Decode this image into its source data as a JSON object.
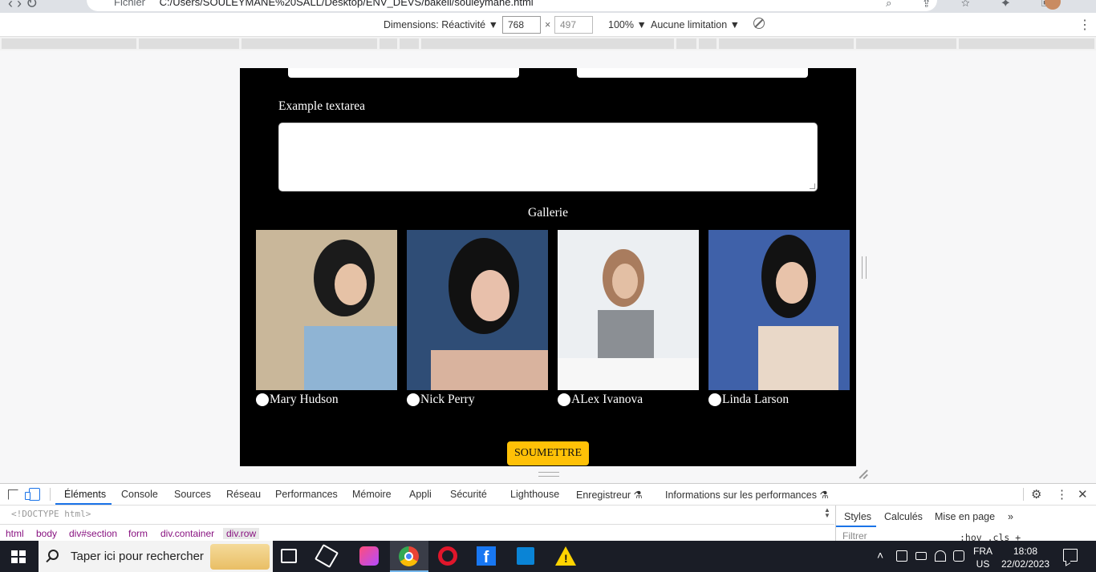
{
  "browser": {
    "url_scheme": "Fichier",
    "url_path": "C:/Users/SOULEYMANE%20SALL/Desktop/ENV_DEVS/bakeli/souleymane.html"
  },
  "device_toolbar": {
    "dimensions_label": "Dimensions: Réactivité ▼",
    "width_value": "768",
    "height_placeholder": "497",
    "zoom_label": "100% ▼",
    "throttle_label": "Aucune limitation ▼"
  },
  "page": {
    "textarea_label": "Example textarea",
    "gallery_title": "Gallerie",
    "gallery": [
      {
        "name": "Mary Hudson",
        "photo_colors": [
          "#c9b79a",
          "#1b1b1b",
          "#8fb4d4"
        ]
      },
      {
        "name": "Nick Perry",
        "photo_colors": [
          "#2f4d76",
          "#111111",
          "#e8c0ab"
        ]
      },
      {
        "name": "ALex Ivanova",
        "photo_colors": [
          "#eceff2",
          "#a97c5e",
          "#8b8f94"
        ]
      },
      {
        "name": "Linda Larson",
        "photo_colors": [
          "#3f61a9",
          "#121212",
          "#e9d8c8"
        ]
      }
    ],
    "submit_label": "SOUMETTRE",
    "submit_color": "#ffc107",
    "background_color": "#000000"
  },
  "devtools": {
    "tabs": [
      "Éléments",
      "Console",
      "Sources",
      "Réseau",
      "Performances",
      "Mémoire",
      "Appli",
      "Sécurité",
      "Lighthouse",
      "Enregistreur ⚗",
      "Informations sur les performances ⚗"
    ],
    "active_tab": "Éléments",
    "doctype": "<!DOCTYPE html>",
    "breadcrumbs": [
      "html",
      "body",
      "div#section",
      "form",
      "div.container",
      "div.row"
    ],
    "styles_tabs": [
      "Styles",
      "Calculés",
      "Mise en page",
      "»"
    ],
    "filter_placeholder": "Filtrer",
    "hov_cls": ":hov  .cls  +"
  },
  "taskbar": {
    "search_placeholder": "Taper ici pour rechercher",
    "lang_top": "FRA",
    "lang_bottom": "US",
    "time": "18:08",
    "date": "22/02/2023"
  }
}
